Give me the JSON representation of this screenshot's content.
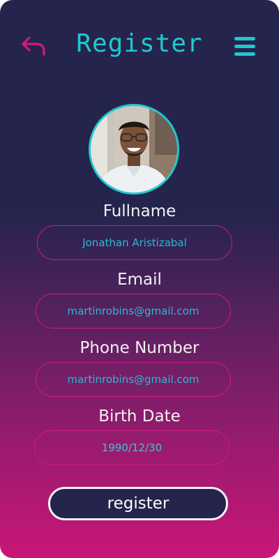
{
  "header": {
    "title": "Register",
    "back_icon": "undo-arrow-icon",
    "menu_icon": "hamburger-menu-icon"
  },
  "profile": {
    "avatar": "profile-photo"
  },
  "form": {
    "fullname": {
      "label": "Fullname",
      "value": "Jonathan Aristizabal"
    },
    "email": {
      "label": "Email",
      "value": "martinrobins@gmail.com"
    },
    "phone": {
      "label": "Phone Number",
      "value": "martinrobins@gmail.com"
    },
    "birthdate": {
      "label": "Birth Date",
      "value": "1990/12/30"
    }
  },
  "actions": {
    "register_label": "register"
  },
  "colors": {
    "accent": "#1ec9cf",
    "pink": "#d31a7b",
    "bg_top": "#25244d",
    "bg_bottom": "#c91677"
  }
}
